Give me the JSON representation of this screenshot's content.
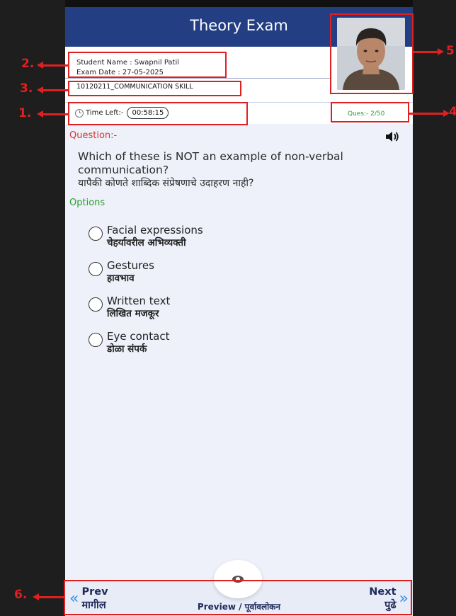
{
  "header": {
    "title": "Theory Exam"
  },
  "student": {
    "name_line": "Student Name : Swapnil Patil",
    "date_line": "Exam Date : 27-05-2025"
  },
  "course": {
    "code_name": "10120211_COMMUNICATION SKILL"
  },
  "timer": {
    "label": "Time Left:-",
    "value": "00:58:15",
    "icon": "clock-icon"
  },
  "question_counter": "Ques:- 2/50",
  "question": {
    "label": "Question:-",
    "text_en": "Which of these is NOT an example of non-verbal communication?",
    "text_mr": "यापैकी कोणते शाब्दिक संप्रेषणाचे उदाहरण नाही?"
  },
  "options_label": "Options",
  "options": [
    {
      "en": "Facial expressions",
      "mr": "चेहर्यावरील अभिव्यक्ती"
    },
    {
      "en": "Gestures",
      "mr": "हावभाव"
    },
    {
      "en": "Written text",
      "mr": "लिखित मजकूर"
    },
    {
      "en": "Eye contact",
      "mr": "डोळा संपर्क"
    }
  ],
  "nav": {
    "prev_en": "Prev",
    "prev_mr": "मागील",
    "next_en": "Next",
    "next_mr": "पुढे",
    "preview": "Preview / पूर्वावलोकन"
  },
  "annotations": [
    "1.",
    "2.",
    "3.",
    "4",
    "5",
    "6."
  ],
  "colors": {
    "header": "#233e82",
    "question_label": "#d8352f",
    "options_label": "#2aa02a",
    "annotation": "#e02020",
    "chevron": "#3a8fe0"
  }
}
